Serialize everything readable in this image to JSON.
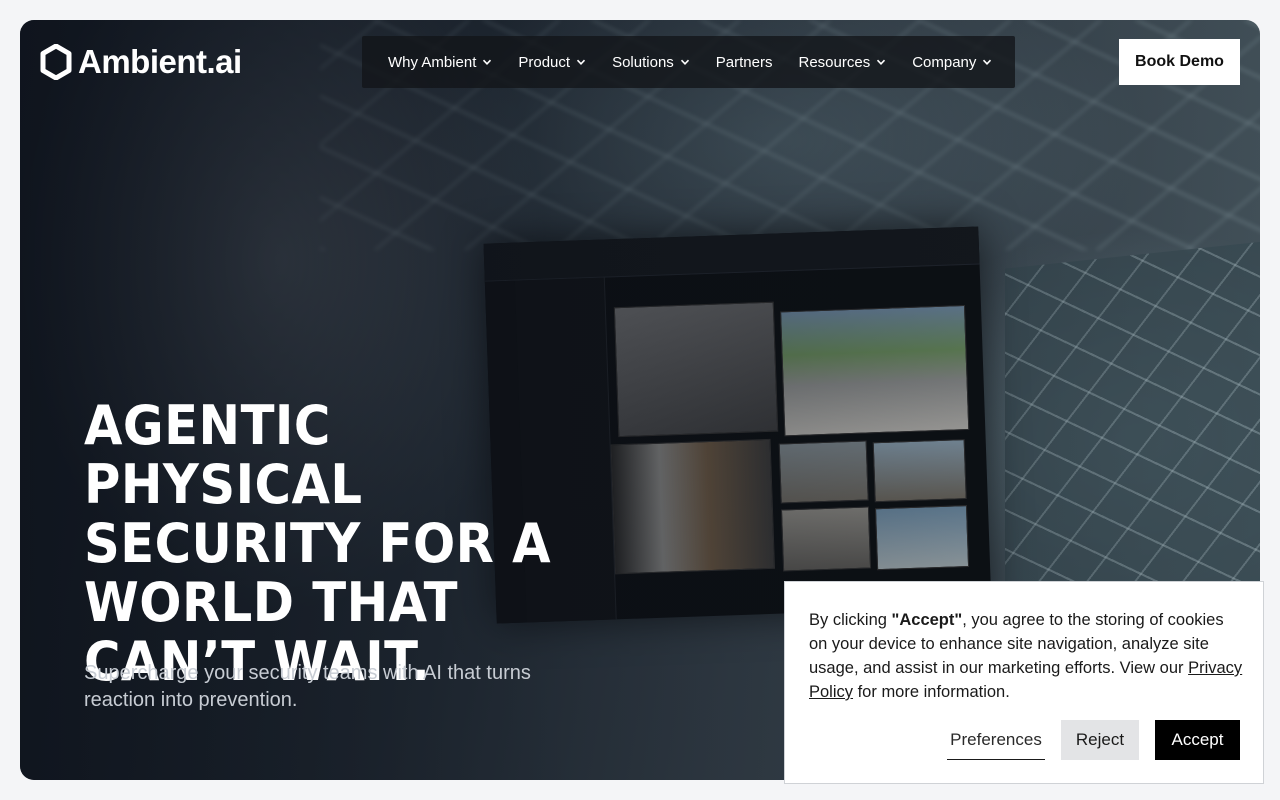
{
  "brand": {
    "name": "Ambient.ai"
  },
  "nav": {
    "items": [
      {
        "label": "Why Ambient",
        "has_dropdown": true
      },
      {
        "label": "Product",
        "has_dropdown": true
      },
      {
        "label": "Solutions",
        "has_dropdown": true
      },
      {
        "label": "Partners",
        "has_dropdown": false
      },
      {
        "label": "Resources",
        "has_dropdown": true
      },
      {
        "label": "Company",
        "has_dropdown": true
      }
    ]
  },
  "header": {
    "cta_label": "Book Demo"
  },
  "hero": {
    "headline": "AGENTIC PHYSICAL SECURITY FOR A WORLD THAT CAN’T WAIT.",
    "subtext": "Supercharge your security teams with AI that turns reaction into prevention."
  },
  "cookie_banner": {
    "text_before": "By clicking ",
    "text_bold": "\"Accept\"",
    "text_after": ", you agree to the storing of cookies on your device to enhance site navigation, analyze site usage, and assist in our marketing efforts. View our ",
    "link_label": "Privacy Policy",
    "text_end": " for more information.",
    "preferences_label": "Preferences",
    "reject_label": "Reject",
    "accept_label": "Accept"
  },
  "colors": {
    "accent_dark": "#000000",
    "nav_bg": "#121418",
    "subtext": "#c7ccd3"
  },
  "icons": {
    "logo": "hexagon-logo-icon",
    "dropdown": "chevron-down-icon"
  }
}
